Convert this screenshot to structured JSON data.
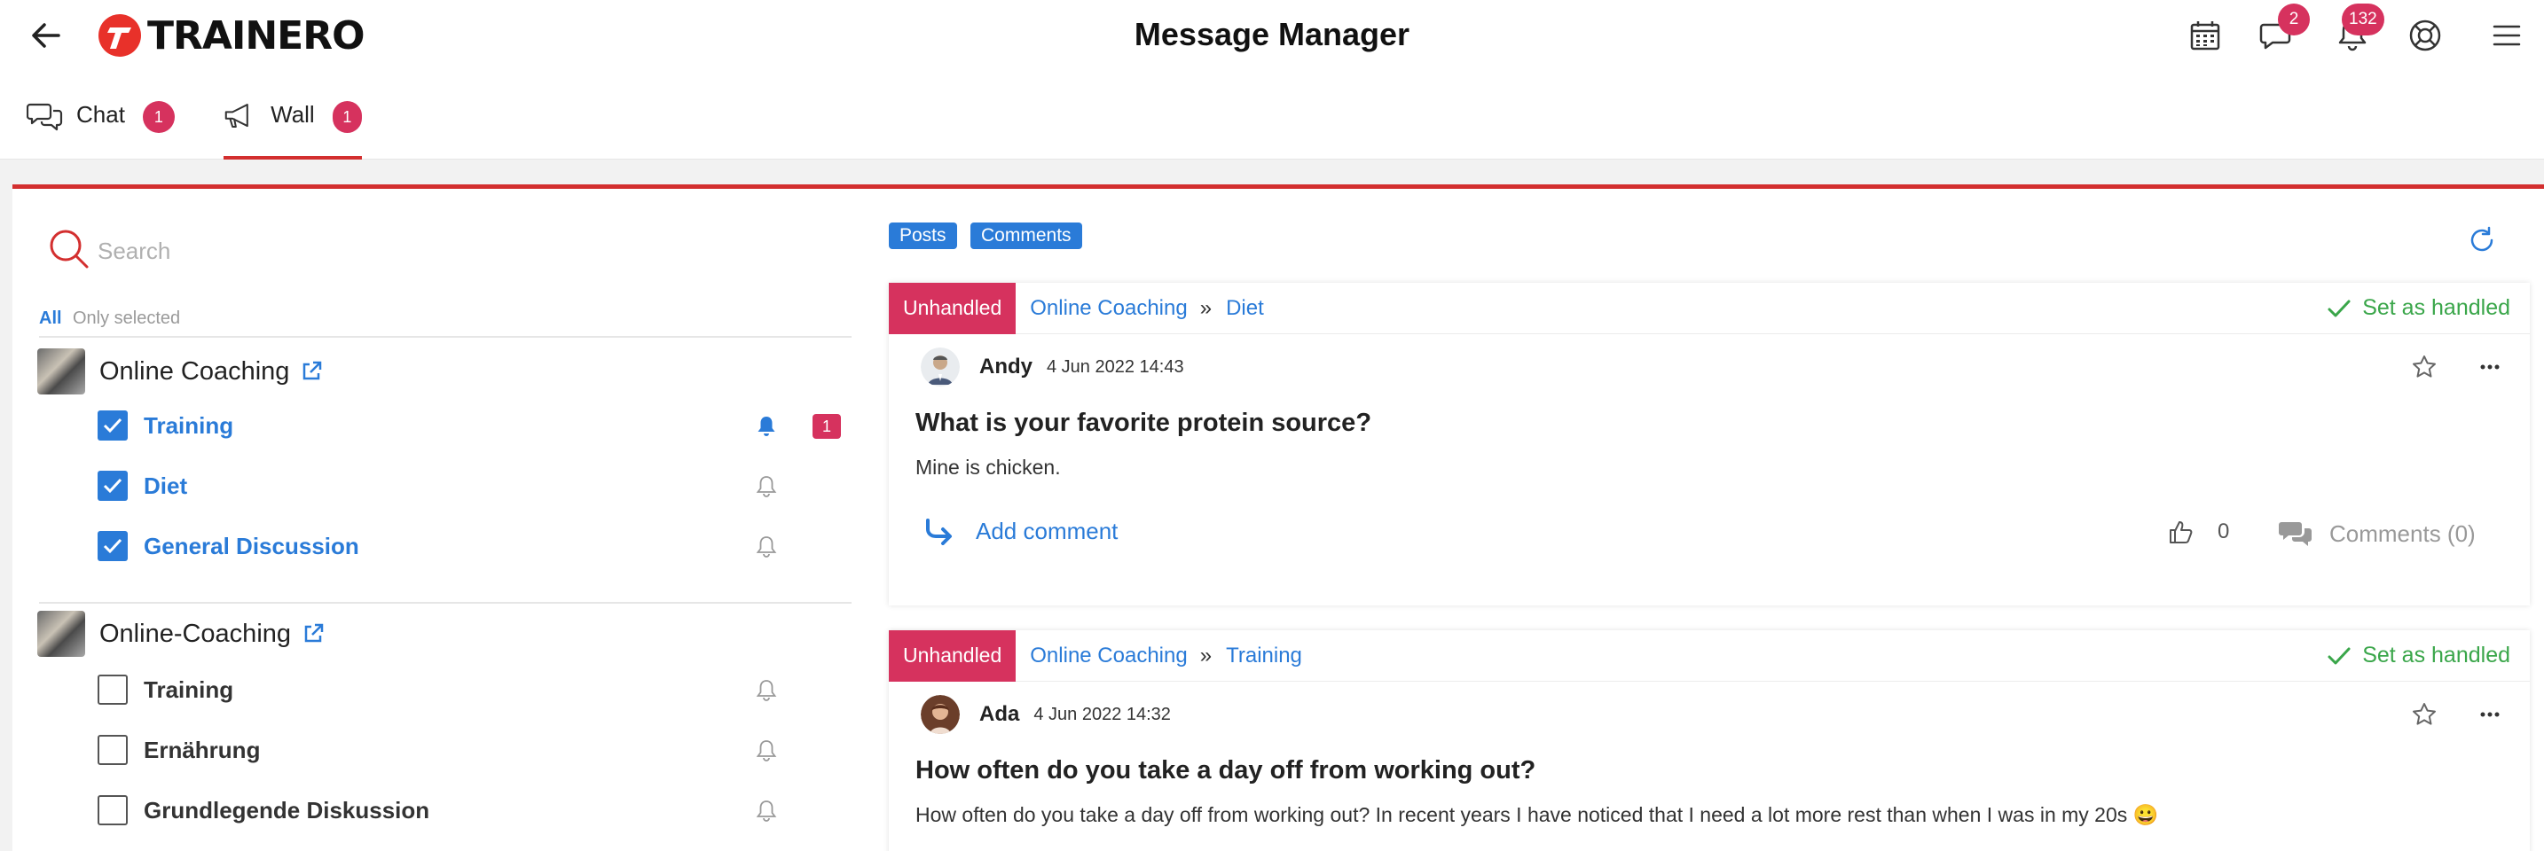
{
  "app": {
    "logo_text": "TRAINERO",
    "title": "Message Manager"
  },
  "topbar": {
    "icons": [
      "back-arrow-icon",
      "calendar-icon",
      "chat-icon",
      "bell-icon",
      "help-icon",
      "menu-icon"
    ],
    "chat_badge": "2",
    "notifications_badge": "132"
  },
  "tabs": [
    {
      "label": "Chat",
      "badge": "1",
      "icon": "chat-icon",
      "active": false
    },
    {
      "label": "Wall",
      "badge": "1",
      "icon": "megaphone-icon",
      "active": true
    }
  ],
  "sidebar": {
    "search_placeholder": "Search",
    "filters": {
      "all": "All",
      "only_selected": "Only selected"
    },
    "groups": [
      {
        "name": "Online Coaching",
        "items": [
          {
            "label": "Training",
            "checked": true,
            "bell_active": true,
            "badge": "1"
          },
          {
            "label": "Diet",
            "checked": true,
            "bell_active": false
          },
          {
            "label": "General Discussion",
            "checked": true,
            "bell_active": false
          }
        ]
      },
      {
        "name": "Online-Coaching",
        "items": [
          {
            "label": "Training",
            "checked": false,
            "bell_active": false
          },
          {
            "label": "Ernährung",
            "checked": false,
            "bell_active": false
          },
          {
            "label": "Grundlegende Diskussion",
            "checked": false,
            "bell_active": false
          }
        ]
      }
    ]
  },
  "feed": {
    "chips": [
      "Posts",
      "Comments"
    ],
    "posts": [
      {
        "status": "Unhandled",
        "breadcrumb": [
          "Online Coaching",
          "Diet"
        ],
        "separator": "»",
        "handled_label": "Set as handled",
        "author": "Andy",
        "date": "4 Jun 2022 14:43",
        "title": "What is your favorite protein source?",
        "body": "Mine is chicken.",
        "add_comment": "Add comment",
        "likes": "0",
        "comments_label": "Comments (0)"
      },
      {
        "status": "Unhandled",
        "breadcrumb": [
          "Online Coaching",
          "Training"
        ],
        "separator": "»",
        "handled_label": "Set as handled",
        "author": "Ada",
        "date": "4 Jun 2022 14:32",
        "title": "How often do you take a day off from working out?",
        "body": "How often do you take a day off from working out? In recent years I have noticed that I need a lot more rest than when I was in my 20s 😀"
      }
    ]
  },
  "colors": {
    "accent_red": "#d32f2f",
    "badge": "#d6325e",
    "link_blue": "#2a7bd8",
    "handled_green": "#3aa64a"
  }
}
